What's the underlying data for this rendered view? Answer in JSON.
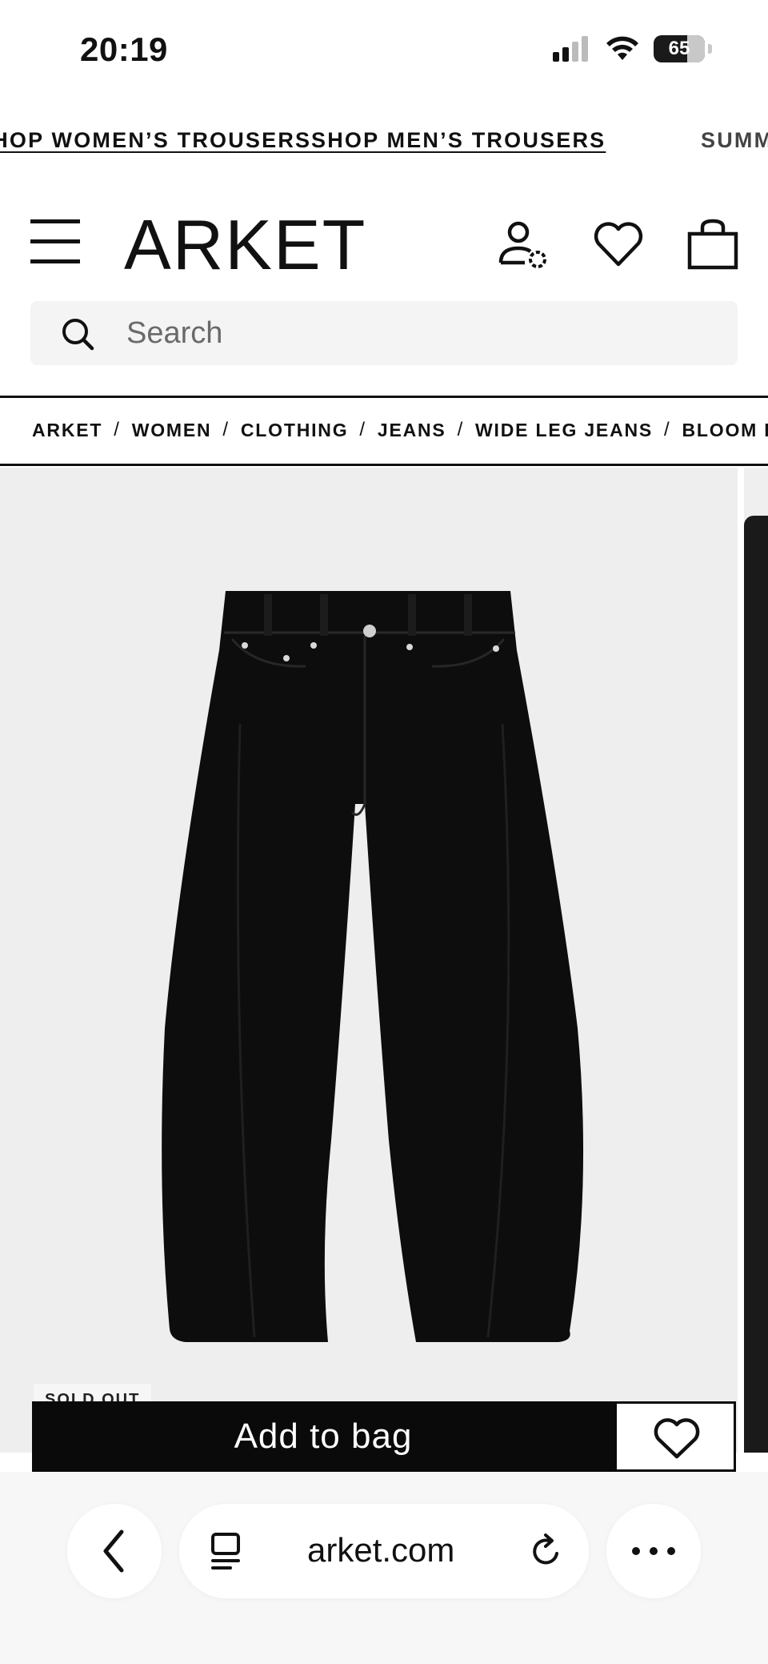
{
  "status_bar": {
    "time": "20:19",
    "battery": "65",
    "icons": [
      "signal-icon",
      "wifi-icon",
      "battery-icon"
    ]
  },
  "promo": {
    "items": [
      "SHOP WOMEN’S TROUSERS",
      "SHOP MEN’S TROUSERS",
      "SUMMER"
    ]
  },
  "header": {
    "logo": "ARKET",
    "icons": [
      "menu-icon",
      "account-icon",
      "wishlist-icon",
      "bag-icon"
    ]
  },
  "search": {
    "placeholder": "Search"
  },
  "breadcrumb": {
    "items": [
      "ARKET",
      "WOMEN",
      "CLOTHING",
      "JEANS",
      "WIDE LEG JEANS",
      "BLOOM BARREL JEANS"
    ],
    "separator": "/"
  },
  "product": {
    "badge": "SOLD OUT",
    "add_to_bag": "Add to bag",
    "image_bg": "#efeeee",
    "garment_color": "#0d0d0d"
  },
  "browser": {
    "url": "arket.com",
    "icons": [
      "back-icon",
      "tabs-icon",
      "reload-icon",
      "more-icon"
    ]
  }
}
